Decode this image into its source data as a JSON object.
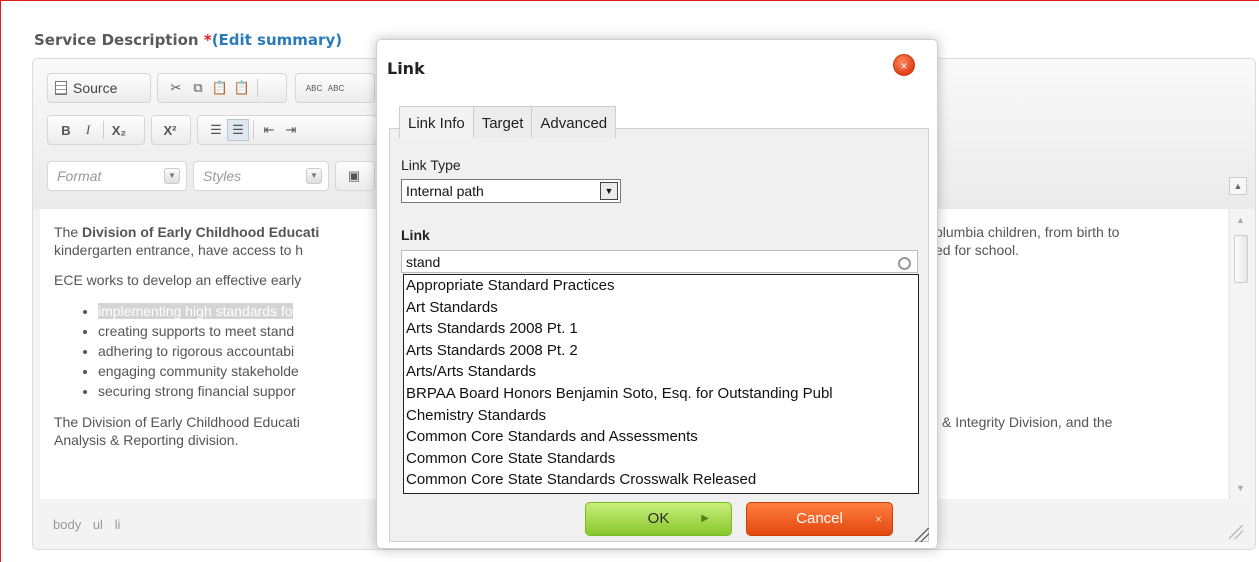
{
  "section": {
    "title": "Service Description ",
    "required_mark": "*",
    "edit_link": "(Edit summary)"
  },
  "toolbar": {
    "source_label": "Source",
    "format_placeholder": "Format",
    "styles_placeholder": "Styles",
    "bold": "B",
    "italic": "I",
    "subscript": "X₂",
    "superscript": "X²",
    "spellcheck_1": "ABC",
    "spellcheck_2": "ABC"
  },
  "editor": {
    "p1_prefix": "The ",
    "p1_bold": "Division of Early Childhood Educati",
    "p1_right": "olumbia children, from birth to",
    "p1_line2_left": "kindergarten entrance, have access to h",
    "p1_line2_right": "ed for school.",
    "p2": "ECE works to develop an effective early",
    "bullets": [
      "implementing high standards fo",
      "creating supports to meet stand",
      "adhering to rigorous accountabi",
      "engaging community stakeholde",
      "securing strong financial suppor"
    ],
    "p3_left": "The Division of Early Childhood Educati",
    "p3_right": "& Integrity Division, and the",
    "p3_line2": "Analysis & Reporting division.",
    "path": [
      "body",
      "ul",
      "li"
    ]
  },
  "dialog": {
    "title": "Link",
    "close_symbol": "×",
    "tabs": [
      "Link Info",
      "Target",
      "Advanced"
    ],
    "link_type_label": "Link Type",
    "link_type_value": "Internal path",
    "link_label": "Link",
    "link_value": "stand",
    "suggestions": [
      "Appropriate Standard Practices",
      "Art Standards",
      "Arts Standards 2008 Pt. 1",
      "Arts Standards 2008 Pt. 2",
      "Arts/Arts Standards",
      "BRPAA Board Honors Benjamin Soto, Esq. for Outstanding Publ",
      "Chemistry Standards",
      "Common Core Standards and Assessments",
      "Common Core State Standards",
      "Common Core State Standards Crosswalk Released"
    ],
    "ok_label": "OK",
    "cancel_label": "Cancel",
    "cancel_icon": "×"
  },
  "colors": {
    "frame_border": "#e31b23",
    "ok_button": "#9ad63c",
    "cancel_button": "#f05a1e",
    "edit_link": "#2a7bb9"
  }
}
